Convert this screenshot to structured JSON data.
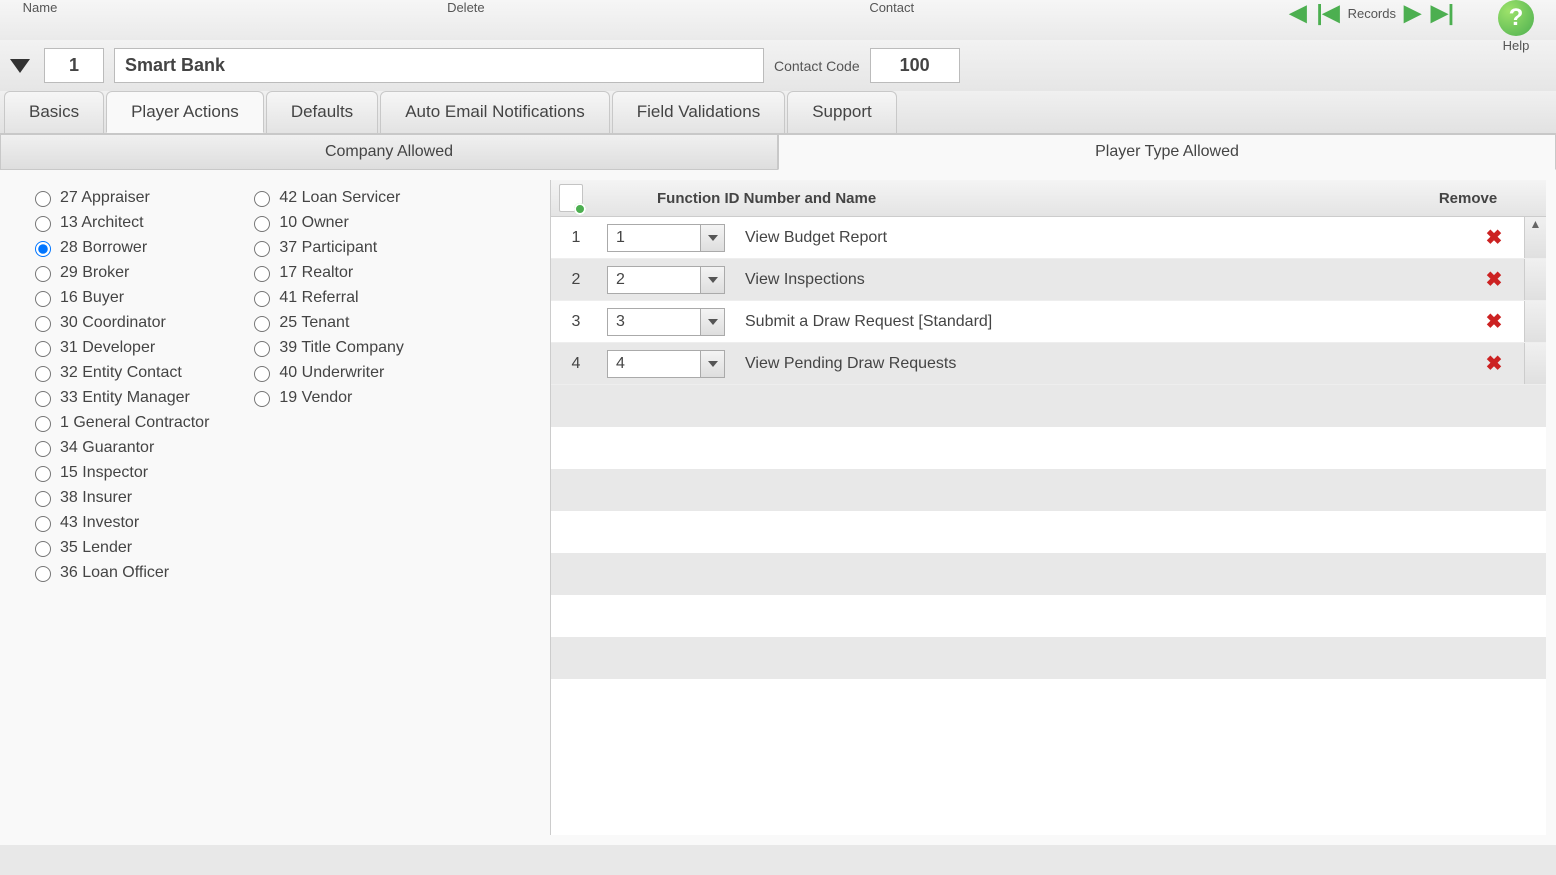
{
  "toolbar": {
    "name_label": "Name",
    "delete_label": "Delete",
    "contact_label": "Contact",
    "records_label": "Records",
    "help_label": "Help"
  },
  "header": {
    "id_value": "1",
    "name_value": "Smart Bank",
    "code_label": "Contact Code",
    "code_value": "100"
  },
  "tabs": [
    {
      "label": "Basics"
    },
    {
      "label": "Player Actions"
    },
    {
      "label": "Defaults"
    },
    {
      "label": "Auto Email Notifications"
    },
    {
      "label": "Field Validations"
    },
    {
      "label": "Support"
    }
  ],
  "subtabs": {
    "company": "Company Allowed",
    "player": "Player Type Allowed"
  },
  "player_types_col1": [
    {
      "id": "27",
      "name": "Appraiser"
    },
    {
      "id": "13",
      "name": "Architect"
    },
    {
      "id": "28",
      "name": "Borrower",
      "checked": true
    },
    {
      "id": "29",
      "name": "Broker"
    },
    {
      "id": "16",
      "name": "Buyer"
    },
    {
      "id": "30",
      "name": "Coordinator"
    },
    {
      "id": "31",
      "name": "Developer"
    },
    {
      "id": "32",
      "name": "Entity Contact"
    },
    {
      "id": "33",
      "name": "Entity Manager"
    },
    {
      "id": "1",
      "name": "General Contractor"
    },
    {
      "id": "34",
      "name": "Guarantor"
    },
    {
      "id": "15",
      "name": "Inspector"
    },
    {
      "id": "38",
      "name": "Insurer"
    },
    {
      "id": "43",
      "name": "Investor"
    },
    {
      "id": "35",
      "name": "Lender"
    },
    {
      "id": "36",
      "name": "Loan Officer"
    }
  ],
  "player_types_col2": [
    {
      "id": "42",
      "name": "Loan Servicer"
    },
    {
      "id": "10",
      "name": "Owner"
    },
    {
      "id": "37",
      "name": "Participant"
    },
    {
      "id": "17",
      "name": "Realtor"
    },
    {
      "id": "41",
      "name": "Referral"
    },
    {
      "id": "25",
      "name": "Tenant"
    },
    {
      "id": "39",
      "name": "Title Company"
    },
    {
      "id": "40",
      "name": "Underwriter"
    },
    {
      "id": "19",
      "name": "Vendor"
    }
  ],
  "function_table": {
    "header_main": "Function ID Number and Name",
    "header_remove": "Remove",
    "rows": [
      {
        "n": "1",
        "fid": "1",
        "fname": "View Budget Report"
      },
      {
        "n": "2",
        "fid": "2",
        "fname": "View Inspections"
      },
      {
        "n": "3",
        "fid": "3",
        "fname": "Submit a Draw Request [Standard]"
      },
      {
        "n": "4",
        "fid": "4",
        "fname": "View Pending Draw Requests"
      }
    ]
  }
}
